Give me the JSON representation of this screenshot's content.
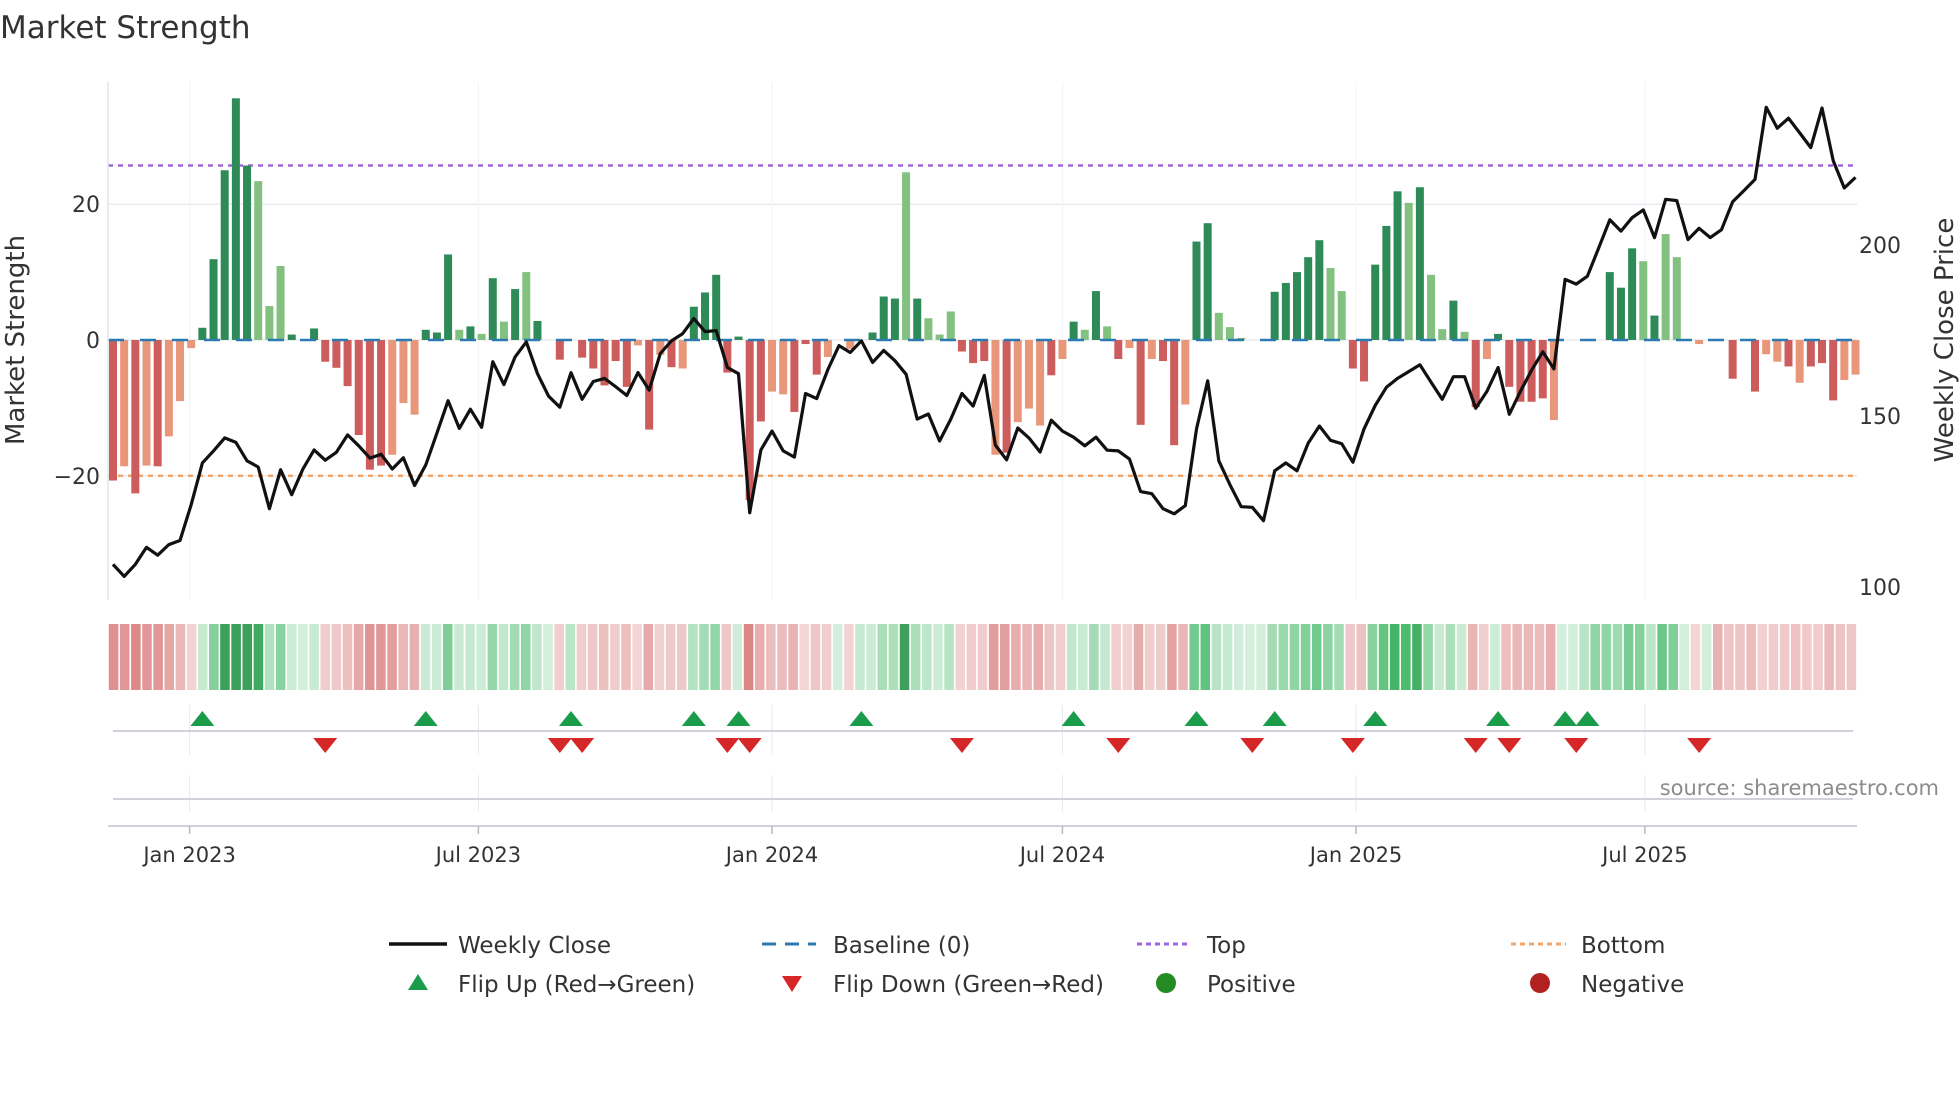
{
  "chart_data": {
    "type": "bar",
    "title": "Market Strength",
    "ylabel": "Market Strength",
    "y2label": "Weekly Close Price",
    "x_start": "2022-11-14",
    "x_freq": "weekly",
    "ylim": [
      -38.3,
      38
    ],
    "y2lim": [
      96.2,
      247.7
    ],
    "yticks": [
      {
        "v": -20,
        "label": "−20"
      },
      {
        "v": 0,
        "label": "0"
      },
      {
        "v": 20,
        "label": "20"
      }
    ],
    "y2ticks": [
      {
        "v": 100,
        "label": "100"
      },
      {
        "v": 150,
        "label": "150"
      },
      {
        "v": 200,
        "label": "200"
      }
    ],
    "xticks": [
      {
        "date": "2023-01-01",
        "label": "Jan 2023"
      },
      {
        "date": "2023-07-01",
        "label": "Jul 2023"
      },
      {
        "date": "2024-01-01",
        "label": "Jan 2024"
      },
      {
        "date": "2024-07-01",
        "label": "Jul 2024"
      },
      {
        "date": "2025-01-01",
        "label": "Jan 2025"
      },
      {
        "date": "2025-07-01",
        "label": "Jul 2025"
      }
    ],
    "top_level": 25.7,
    "bottom_level": -20,
    "baseline": 0,
    "strength": [
      -20.7,
      -18.6,
      -22.6,
      -18.5,
      -18.6,
      -14.2,
      -9,
      -1.2,
      1.8,
      11.9,
      25,
      35.6,
      25.7,
      23.4,
      5,
      10.9,
      0.8,
      0,
      1.7,
      -3.2,
      -4.1,
      -6.8,
      -14,
      -19.1,
      -18.5,
      -16.9,
      -9.3,
      -11,
      1.5,
      1.1,
      12.6,
      1.5,
      2,
      0.9,
      9.1,
      2.7,
      7.5,
      10,
      2.8,
      0,
      -2.9,
      3.5,
      -2.6,
      -4.2,
      -6.7,
      -3.1,
      -6.9,
      -0.8,
      -13.2,
      -2.2,
      -4,
      -4.2,
      4.9,
      7,
      9.6,
      -4.8,
      0.5,
      -23.6,
      -12,
      -7.6,
      -8,
      -10.6,
      -0.6,
      -5.1,
      -2.5,
      0,
      -1.3,
      2.1,
      1.1,
      6.4,
      6.1,
      24.7,
      6.1,
      3.2,
      0.8,
      4.2,
      -1.7,
      -3.4,
      -3.1,
      -16.9,
      -16.6,
      -12.1,
      -10.1,
      -12.6,
      -5.2,
      -2.8,
      2.7,
      1.5,
      7.2,
      2,
      -2.8,
      -1.2,
      -12.5,
      -2.8,
      -3.1,
      -15.5,
      -9.5,
      14.5,
      17.2,
      4,
      1.9,
      0.3,
      0,
      0,
      7.1,
      8.4,
      10,
      12.2,
      14.7,
      10.6,
      7.2,
      -4.2,
      -6.1,
      11.1,
      16.8,
      21.9,
      20.2,
      22.5,
      9.6,
      1.6,
      5.8,
      1.2,
      -9.9,
      -2.8,
      0.9,
      -6.9,
      -9.1,
      -9.1,
      -8.6,
      -11.8,
      0,
      0,
      4.1,
      9.8,
      10,
      7.7,
      13.5,
      11.6,
      3.6,
      15.6,
      12.2,
      0,
      -0.6,
      0,
      -10.7,
      -5.7,
      -5.3,
      -7.6,
      -2.1,
      -3.2,
      -3.9,
      -6.3,
      -3.9,
      -3.4,
      -8.9,
      -5.9,
      -5.1
    ],
    "shade": "dldldllldddddllldzdddddddllldddldldldldddzdddddldldldddddddlldddldlzdddldllldddldllldldldldldlddlddlllzzdddddlldddddldlldldldddddlddzzdddldlldldzdzdlldldddlldll",
    "weekly_close": [
      106.6,
      103.1,
      106.6,
      111.6,
      109.3,
      112.4,
      113.6,
      124.1,
      136.3,
      139.8,
      143.6,
      142.3,
      136.9,
      135.1,
      122.9,
      134.3,
      127,
      134.5,
      140.1,
      137.1,
      139.4,
      144.5,
      141.3,
      137.7,
      138.8,
      134.5,
      137.8,
      129.7,
      135.7,
      145,
      154.5,
      146.4,
      152,
      146.7,
      165.9,
      159.2,
      167.3,
      171.7,
      162.4,
      155.8,
      152.6,
      162.7,
      154.9,
      160.1,
      161,
      158.6,
      156,
      162.7,
      157.6,
      168.3,
      172,
      174.1,
      178.5,
      174.7,
      175,
      164.2,
      162.4,
      121.7,
      140.1,
      145.6,
      139.8,
      138,
      156.6,
      155.1,
      163.6,
      170.6,
      168.6,
      172,
      165.7,
      169.2,
      166.2,
      162.2,
      149.1,
      150.6,
      142.7,
      149.1,
      156.6,
      152.9,
      161.9,
      141.5,
      137.2,
      146.5,
      143.6,
      139.5,
      148.8,
      145.6,
      143.8,
      141.3,
      143.8,
      140,
      139.8,
      137.4,
      127.9,
      127.3,
      122.9,
      121.4,
      123.8,
      146.2,
      160.3,
      136.9,
      129.9,
      123.5,
      123.3,
      119.4,
      134,
      136.3,
      134,
      142.1,
      147.1,
      142.9,
      141.9,
      136.5,
      146.2,
      153.1,
      158.4,
      161,
      163,
      165,
      159.9,
      154.9,
      161.5,
      161.5,
      152.3,
      157.2,
      164.2,
      150.5,
      157.2,
      163.4,
      168.8,
      163.8,
      190,
      188.6,
      190.9,
      199.1,
      207.4,
      204.1,
      208,
      210.3,
      202.2,
      213.4,
      213,
      201.6,
      204.9,
      202.2,
      204.5,
      212.7,
      215.9,
      219.2,
      240.3,
      234.2,
      237.1,
      232.8,
      228.5,
      240.1,
      224.7,
      216.7,
      219.8
    ],
    "flip_up_index": [
      8,
      28,
      41,
      52,
      56,
      67,
      86,
      97,
      104,
      113,
      124,
      130,
      132
    ],
    "flip_down_index": [
      19,
      40,
      42,
      55,
      57,
      76,
      90,
      102,
      111,
      122,
      125,
      131,
      142
    ],
    "legend": {
      "weekly_close": "Weekly Close",
      "baseline": "Baseline (0)",
      "top": "Top",
      "bottom": "Bottom",
      "flip_up": "Flip Up (Red→Green)",
      "flip_down": "Flip Down (Green→Red)",
      "positive": "Positive",
      "negative": "Negative"
    },
    "source": "source: sharemaestro.com",
    "colors": {
      "pos_dark": "#2e8b57",
      "pos_light": "#82c17f",
      "neg_dark": "#cd5c5c",
      "neg_light": "#e8977a",
      "top": "#a066e0",
      "bottom": "#f0a56a",
      "baseline": "#2b7bb0",
      "line": "#111111",
      "flip_up": "#1a9c4a",
      "flip_down": "#d62728",
      "positive": "#228b22",
      "negative": "#b22222"
    }
  }
}
